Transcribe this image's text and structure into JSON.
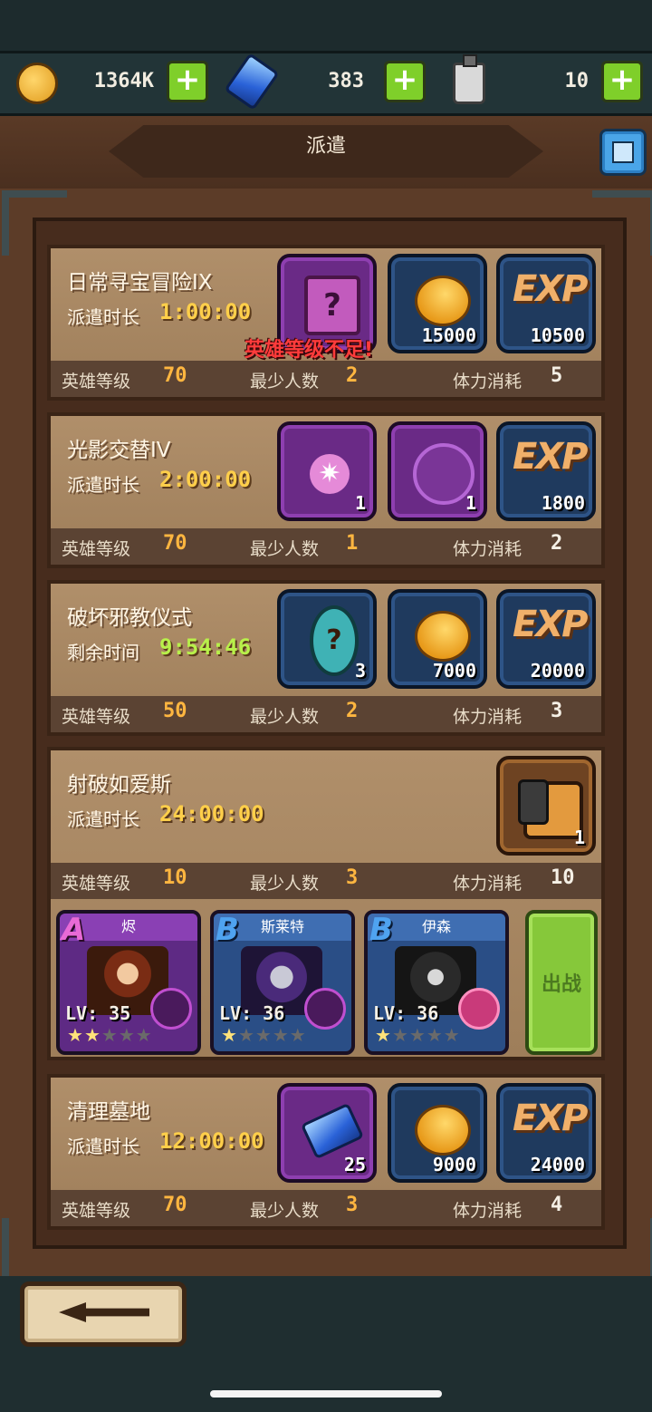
{
  "resources": {
    "gold": {
      "icon": "gold-coin-icon",
      "value": "1364K"
    },
    "gems": {
      "icon": "blue-gem-icon",
      "value": "383"
    },
    "potion": {
      "icon": "potion-bottle-icon",
      "value": "10"
    }
  },
  "title": "派遣",
  "labels": {
    "hero_level": "英雄等级",
    "min_people": "最少人数",
    "stamina_cost": "体力消耗",
    "go": "出战"
  },
  "missions": [
    {
      "name": "日常寻宝冒险IX",
      "dur_label": "派遣时长",
      "dur_value": "1:00:00",
      "hero_level": "70",
      "min_people": "2",
      "stamina": "5",
      "warning": "英雄等级不足!",
      "rewards": [
        {
          "icon": "mystery-box-icon",
          "count": ""
        },
        {
          "icon": "gold-coin-icon",
          "count": "15000"
        },
        {
          "icon": "exp-icon",
          "count": "10500"
        }
      ]
    },
    {
      "name": "光影交替IV",
      "dur_label": "派遣时长",
      "dur_value": "2:00:00",
      "hero_level": "70",
      "min_people": "1",
      "stamina": "2",
      "rewards": [
        {
          "icon": "spider-rune-icon",
          "count": "1"
        },
        {
          "icon": "moon-rune-icon",
          "count": "1"
        },
        {
          "icon": "exp-icon",
          "count": "1800"
        }
      ]
    },
    {
      "name": "破坏邪教仪式",
      "dur_label": "剩余时间",
      "dur_value": "9:54:46",
      "hero_level": "50",
      "min_people": "2",
      "stamina": "3",
      "rewards": [
        {
          "icon": "mystery-egg-icon",
          "count": "3"
        },
        {
          "icon": "gold-coin-icon",
          "count": "7000"
        },
        {
          "icon": "exp-icon",
          "count": "20000"
        }
      ]
    },
    {
      "name": "射破如爱斯",
      "dur_label": "派遣时长",
      "dur_value": "24:00:00",
      "hero_level": "10",
      "min_people": "3",
      "stamina": "10",
      "rewards": [
        {
          "icon": "armor-chest-icon",
          "count": "1"
        }
      ],
      "heroes": [
        {
          "rank": "A",
          "name": "烬",
          "level": "LV: 35",
          "stars": 2
        },
        {
          "rank": "B",
          "name": "斯莱特",
          "level": "LV: 36",
          "stars": 1
        },
        {
          "rank": "B",
          "name": "伊森",
          "level": "LV: 36",
          "stars": 1
        }
      ]
    },
    {
      "name": "清理墓地",
      "dur_label": "派遣时长",
      "dur_value": "12:00:00",
      "hero_level": "70",
      "min_people": "3",
      "stamina": "4",
      "rewards": [
        {
          "icon": "blue-gem-icon",
          "count": "25"
        },
        {
          "icon": "gold-coin-icon",
          "count": "9000"
        },
        {
          "icon": "exp-icon",
          "count": "24000"
        }
      ]
    }
  ],
  "exp_text": "EXP",
  "mystery_mark": "?",
  "spider_glyph": "✷",
  "star_full": "★",
  "star_empty": "★",
  "colors": {
    "accent_green": "#86c83a",
    "warning_red": "#ff3b3b",
    "timer_yellow": "#ffcf4a",
    "timer_green": "#b8f04a"
  }
}
